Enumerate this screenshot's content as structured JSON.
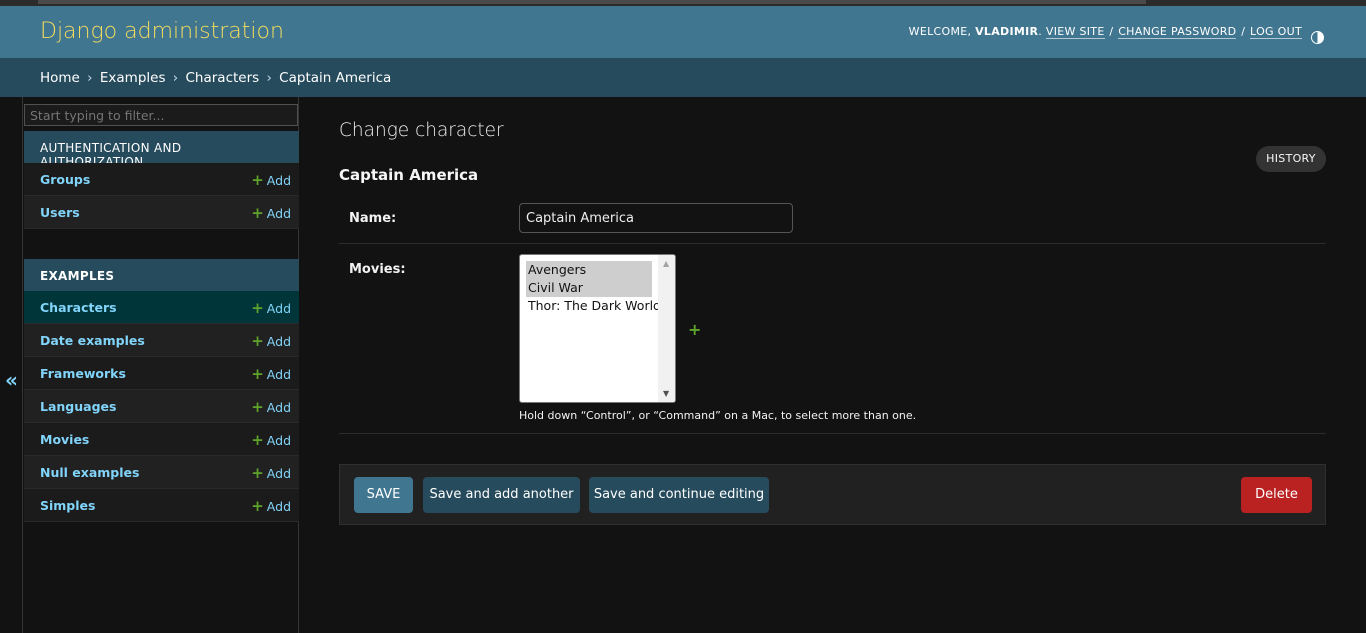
{
  "header": {
    "site_name": "Django administration",
    "welcome": "Welcome,",
    "username": "vladimir",
    "view_site": "View site",
    "change_password": "Change password",
    "log_out": "Log out",
    "sep": "/",
    "theme_toggle_icon": "theme-toggle-icon"
  },
  "breadcrumbs": {
    "items": [
      "Home",
      "Examples",
      "Characters"
    ],
    "current": "Captain America",
    "separator": "›"
  },
  "sidebar": {
    "filter_placeholder": "Start typing to filter...",
    "toggle": "«",
    "apps": [
      {
        "caption": "Authentication and Authorization",
        "models": [
          {
            "name": "Groups",
            "add": "Add"
          },
          {
            "name": "Users",
            "add": "Add"
          }
        ]
      },
      {
        "caption": "Examples",
        "models": [
          {
            "name": "Characters",
            "add": "Add"
          },
          {
            "name": "Date examples",
            "add": "Add"
          },
          {
            "name": "Frameworks",
            "add": "Add"
          },
          {
            "name": "Languages",
            "add": "Add"
          },
          {
            "name": "Movies",
            "add": "Add"
          },
          {
            "name": "Null examples",
            "add": "Add"
          },
          {
            "name": "Simples",
            "add": "Add"
          }
        ]
      }
    ]
  },
  "content": {
    "title": "Change character",
    "object_title": "Captain America",
    "history": "History",
    "name_label": "Name:",
    "name_value": "Captain America",
    "movies_label": "Movies:",
    "movies": [
      {
        "label": "Avengers",
        "selected": true
      },
      {
        "label": "Civil War",
        "selected": true
      },
      {
        "label": "Thor: The Dark World",
        "selected": false
      }
    ],
    "add_movie": "+",
    "help_text": "Hold down “Control”, or “Command” on a Mac, to select more than one."
  },
  "submit_row": {
    "save": "Save",
    "save_add_another": "Save and add another",
    "save_continue": "Save and continue editing",
    "delete": "Delete"
  },
  "colors": {
    "header_bg": "#417690",
    "breadcrumbs_bg": "#264b5d",
    "brand_yellow": "#f5dd5d",
    "link_blue": "#81d4fa",
    "add_green": "#5ea32a",
    "delete_red": "#ba2121",
    "page_bg": "#121212"
  }
}
